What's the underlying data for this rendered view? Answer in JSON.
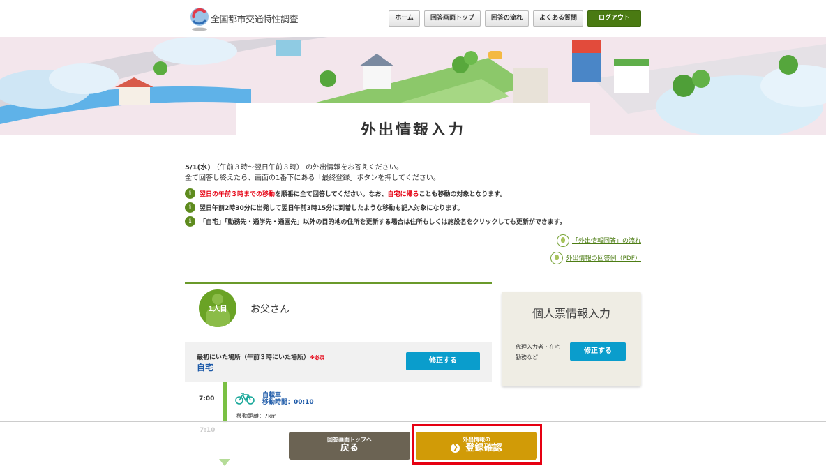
{
  "header": {
    "logo_text": "全国都市交通特性調査",
    "nav": [
      "ホーム",
      "回答画面トップ",
      "回答の流れ",
      "よくある質問"
    ],
    "logout": "ログアウト"
  },
  "page_title": "外出情報入力",
  "intro": {
    "date": "5/1(水)",
    "range": "（午前３時～翌日午前３時）",
    "suffix": "の外出情報をお答えください。",
    "line2": "全て回答し終えたら、画面の1番下にある「最終登録」ボタンを押してください。"
  },
  "notes": {
    "n1_red1": "翌日の午前３時までの移動",
    "n1_mid": "を順番に全て回答してください。なお、",
    "n1_red2": "自宅に帰る",
    "n1_end": "ことも移動の対象となります。",
    "n2": "翌日午前2時30分に出発して翌日午前3時15分に到着したような移動も記入対象になります。",
    "n3": "「自宅」「勤務先・通学先・通園先」以外の目的地の住所を更新する場合は住所もしくは施設名をクリックしても更新ができます。"
  },
  "links": {
    "flow": "「外出情報回答」の流れ",
    "example": "外出情報の回答例（PDF）"
  },
  "person": {
    "number": "1人目",
    "name": "お父さん",
    "first_place_label": "最初にいた場所（午前３時にいた場所）",
    "required": "※必須",
    "first_place_value": "自宅",
    "edit_label": "修正する",
    "trip": {
      "time": "7:00",
      "mode": "自転車",
      "duration_label": "移動時間：00:10",
      "distance_label": "移動距離：7km",
      "next_time": "7:10"
    }
  },
  "side_panel": {
    "title": "個人票情報入力",
    "label_line1": "代理入力者・在宅",
    "label_line2": "勤務など",
    "edit_label": "修正する"
  },
  "footer": {
    "back_small": "回答画面トップへ",
    "back_big": "戻る",
    "confirm_small": "外出情報の",
    "confirm_big": "登録確認",
    "confirm_icon": "❯"
  },
  "colors": {
    "accent_green": "#4a7a12",
    "edit_blue": "#0a9dcc",
    "confirm_gold": "#d19b07",
    "back_gray": "#6b6353",
    "highlight_red": "#e60012"
  }
}
